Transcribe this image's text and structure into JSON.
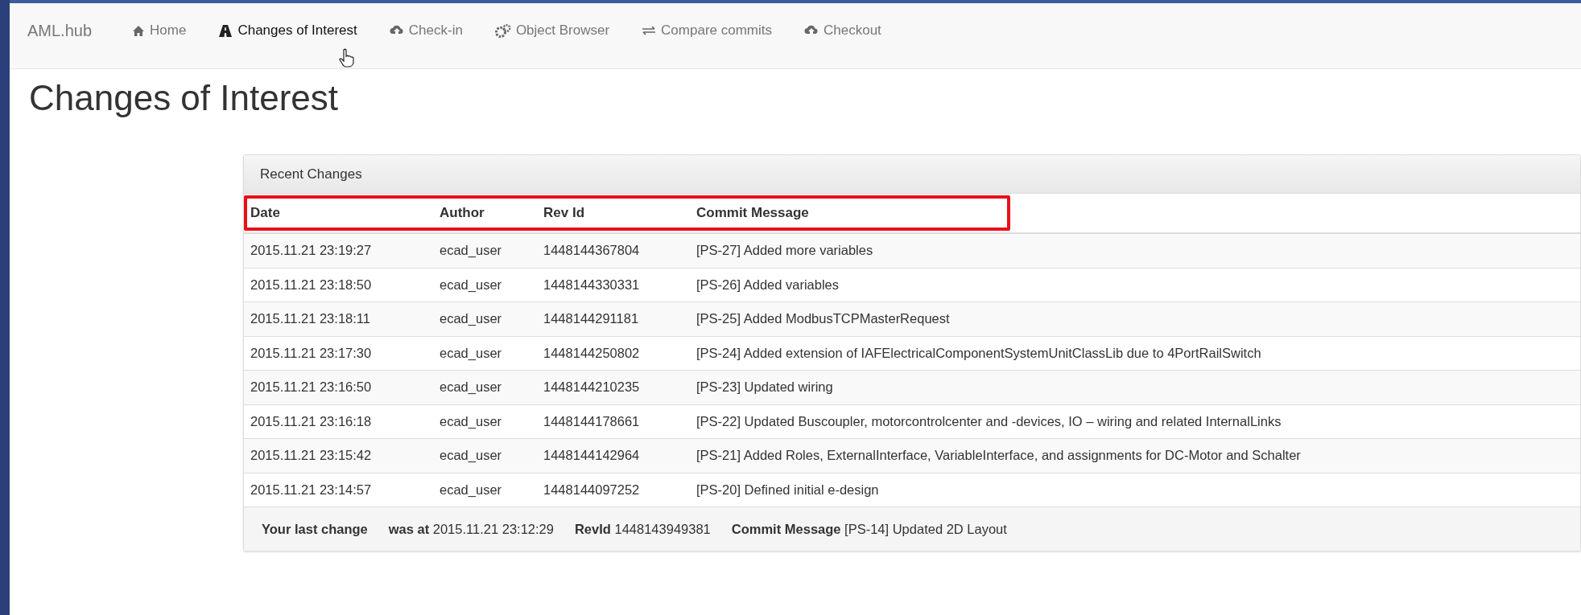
{
  "navbar": {
    "brand": "AML.hub",
    "items": [
      {
        "label": "Home",
        "selected": false
      },
      {
        "label": "Changes of Interest",
        "selected": true
      },
      {
        "label": "Check-in",
        "selected": false
      },
      {
        "label": "Object Browser",
        "selected": false
      },
      {
        "label": "Compare commits",
        "selected": false
      },
      {
        "label": "Checkout",
        "selected": false
      }
    ]
  },
  "page_title": "Changes of Interest",
  "panel": {
    "heading": "Recent Changes",
    "table": {
      "header_highlighted": true,
      "columns": [
        "Date",
        "Author",
        "Rev Id",
        "Commit Message"
      ],
      "rows": [
        [
          "2015.11.21 23:19:27",
          "ecad_user",
          "1448144367804",
          "[PS-27] Added more variables"
        ],
        [
          "2015.11.21 23:18:50",
          "ecad_user",
          "1448144330331",
          "[PS-26] Added variables"
        ],
        [
          "2015.11.21 23:18:11",
          "ecad_user",
          "1448144291181",
          "[PS-25] Added ModbusTCPMasterRequest"
        ],
        [
          "2015.11.21 23:17:30",
          "ecad_user",
          "1448144250802",
          "[PS-24] Added extension of IAFElectricalComponentSystemUnitClassLib due to 4PortRailSwitch"
        ],
        [
          "2015.11.21 23:16:50",
          "ecad_user",
          "1448144210235",
          "[PS-23] Updated wiring"
        ],
        [
          "2015.11.21 23:16:18",
          "ecad_user",
          "1448144178661",
          "[PS-22] Updated Buscoupler, motorcontrolcenter and -devices, IO – wiring and related InternalLinks"
        ],
        [
          "2015.11.21 23:15:42",
          "ecad_user",
          "1448144142964",
          "[PS-21] Added Roles, ExternalInterface, VariableInterface, and assignments for DC-Motor and Schalter"
        ],
        [
          "2015.11.21 23:14:57",
          "ecad_user",
          "1448144097252",
          "[PS-20] Defined initial e-design"
        ]
      ]
    },
    "footer": [
      "**Your last change**",
      "**was at** 2015.11.21 23:12:29",
      "**RevId** 1448143949381",
      "**Commit Message** [PS-14] Updated 2D Layout"
    ]
  }
}
